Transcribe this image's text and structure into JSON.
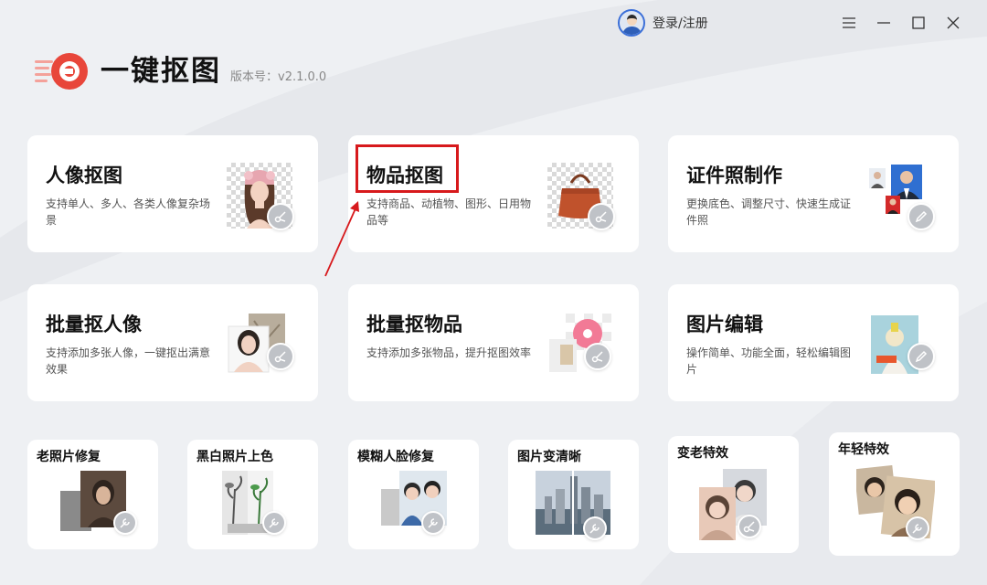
{
  "titlebar": {
    "login_label": "登录/注册",
    "controls": [
      "menu-icon",
      "minimize-icon",
      "maximize-icon",
      "close-icon"
    ]
  },
  "app": {
    "title": "一键抠图",
    "version": "版本号：v2.1.0.0",
    "accent_color": "#e8463a"
  },
  "big_cards": [
    {
      "title": "人像抠图",
      "desc": "支持单人、多人、各类人像复杂场景"
    },
    {
      "title": "物品抠图",
      "desc": "支持商品、动植物、图形、日用物品等"
    },
    {
      "title": "证件照制作",
      "desc": "更换底色、调整尺寸、快速生成证件照"
    },
    {
      "title": "批量抠人像",
      "desc": "支持添加多张人像，一键抠出满意效果"
    },
    {
      "title": "批量抠物品",
      "desc": "支持添加多张物品，提升抠图效率"
    },
    {
      "title": "图片编辑",
      "desc": "操作简单、功能全面，轻松编辑图片"
    }
  ],
  "small_cards": [
    {
      "title": "老照片修复"
    },
    {
      "title": "黑白照片上色"
    },
    {
      "title": "模糊人脸修复"
    },
    {
      "title": "图片变清晰"
    },
    {
      "title": "变老特效"
    },
    {
      "title": "年轻特效"
    }
  ],
  "annotation": {
    "highlight_color": "#d7191c"
  }
}
